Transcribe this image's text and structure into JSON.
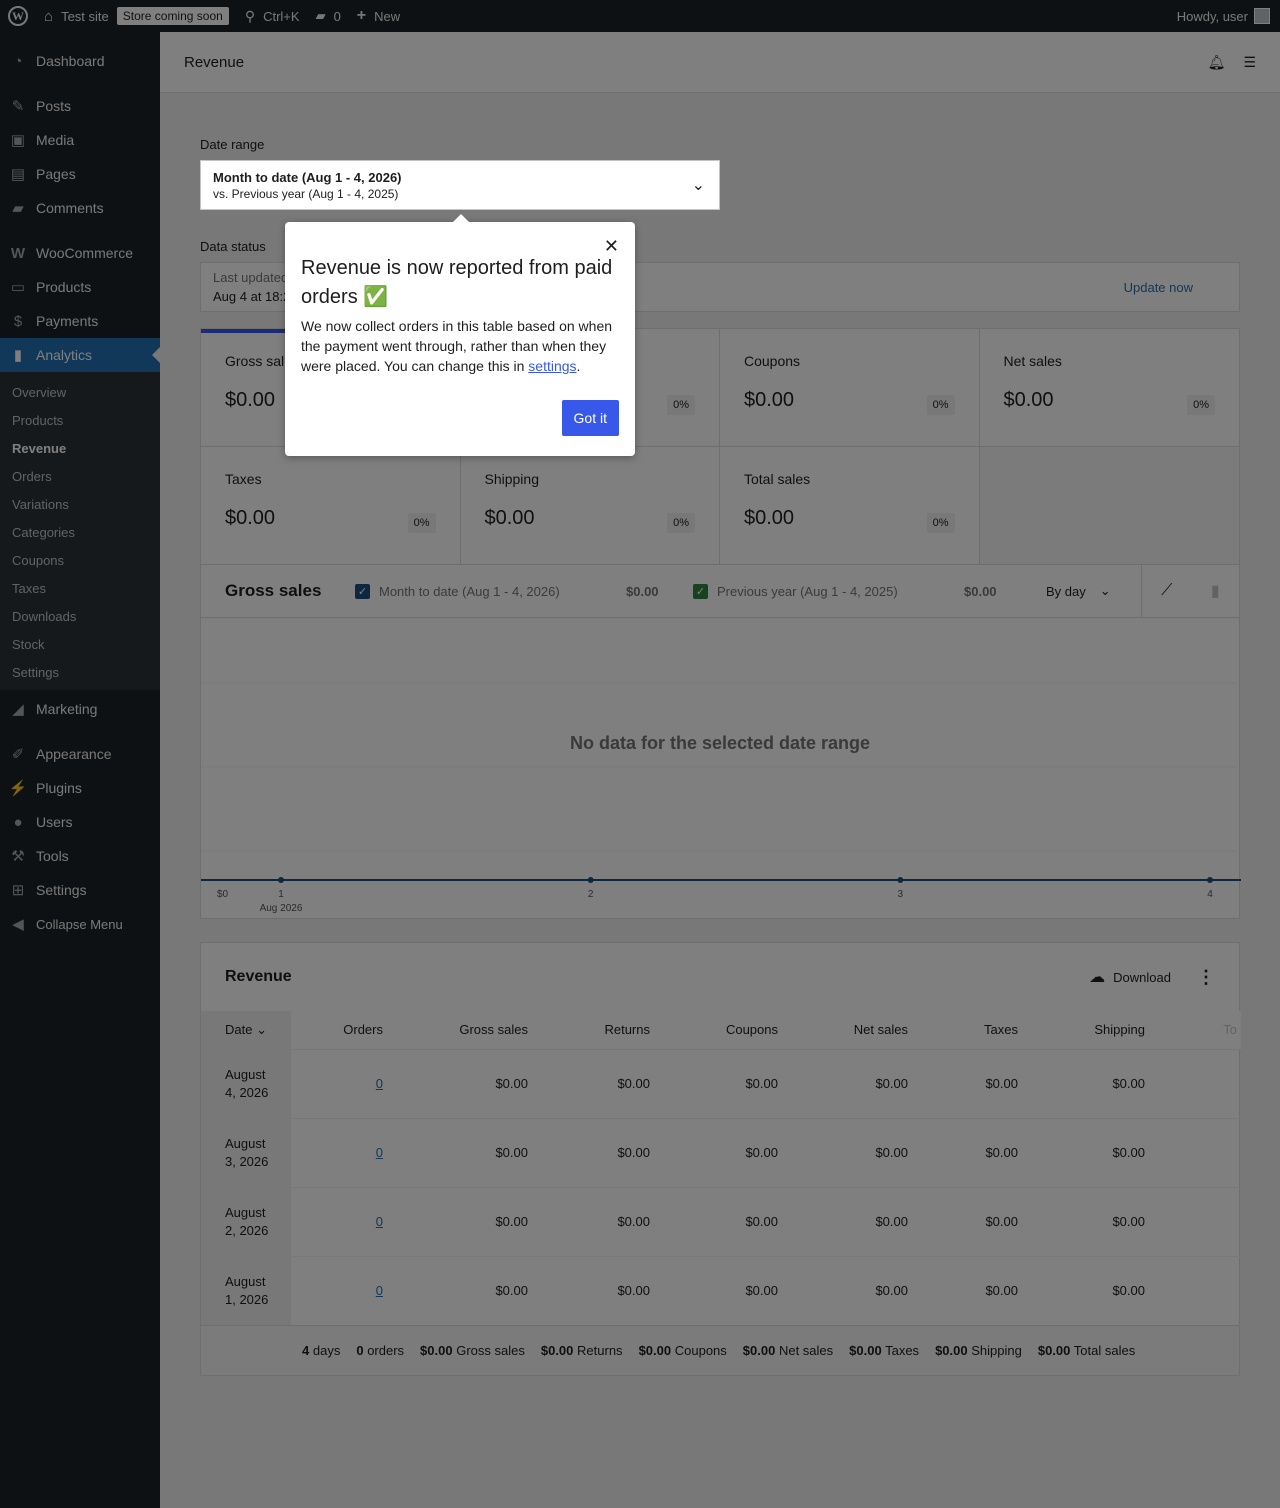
{
  "admin_bar": {
    "site_name": "Test site",
    "store_badge": "Store coming soon",
    "search_shortcut": "Ctrl+K",
    "comments_count": "0",
    "new_label": "New",
    "greeting": "Howdy, user"
  },
  "sidebar": {
    "items_top": [
      {
        "label": "Dashboard",
        "icon": "dashboard-icon"
      },
      {
        "label": "Posts",
        "icon": "pin-icon"
      },
      {
        "label": "Media",
        "icon": "media-icon"
      },
      {
        "label": "Pages",
        "icon": "pages-icon"
      },
      {
        "label": "Comments",
        "icon": "comments-icon"
      },
      {
        "label": "WooCommerce",
        "icon": "woo-icon"
      },
      {
        "label": "Products",
        "icon": "archive-icon"
      },
      {
        "label": "Payments",
        "icon": "dollar-icon"
      },
      {
        "label": "Analytics",
        "icon": "bar-chart-icon"
      }
    ],
    "analytics_submenu": [
      "Overview",
      "Products",
      "Revenue",
      "Orders",
      "Variations",
      "Categories",
      "Coupons",
      "Taxes",
      "Downloads",
      "Stock",
      "Settings"
    ],
    "current_submenu": "Revenue",
    "items_bottom": [
      {
        "label": "Marketing",
        "icon": "megaphone-icon"
      },
      {
        "label": "Appearance",
        "icon": "brush-icon"
      },
      {
        "label": "Plugins",
        "icon": "plug-icon"
      },
      {
        "label": "Users",
        "icon": "user-icon"
      },
      {
        "label": "Tools",
        "icon": "wrench-icon"
      },
      {
        "label": "Settings",
        "icon": "sliders-icon"
      },
      {
        "label": "Collapse Menu",
        "icon": "collapse-icon"
      }
    ]
  },
  "header": {
    "title": "Revenue"
  },
  "date_range": {
    "label": "Date range",
    "primary": "Month to date (Aug 1 - 4, 2026)",
    "secondary": "vs. Previous year (Aug 1 - 4, 2025)"
  },
  "data_status": {
    "label": "Data status",
    "line1": "Last updated",
    "line2": "Aug 4 at 18:2",
    "action": "Update now"
  },
  "summary": [
    {
      "label": "Gross sal",
      "value": "$0.00",
      "delta": ""
    },
    {
      "label": "",
      "value": "",
      "delta": "0%"
    },
    {
      "label": "Coupons",
      "value": "$0.00",
      "delta": "0%"
    },
    {
      "label": "Net sales",
      "value": "$0.00",
      "delta": "0%"
    },
    {
      "label": "Taxes",
      "value": "$0.00",
      "delta": "0%"
    },
    {
      "label": "Shipping",
      "value": "$0.00",
      "delta": "0%"
    },
    {
      "label": "Total sales",
      "value": "$0.00",
      "delta": "0%"
    }
  ],
  "chart": {
    "title": "Gross sales",
    "legend": [
      {
        "label": "Month to date (Aug 1 - 4, 2026)",
        "value": "$0.00",
        "color": "#1d4f7c"
      },
      {
        "label": "Previous year (Aug 1 - 4, 2025)",
        "value": "$0.00",
        "color": "#2e8540"
      }
    ],
    "interval": "By day",
    "no_data": "No data for the selected date range"
  },
  "chart_data": {
    "type": "line",
    "x": [
      "1",
      "2",
      "3",
      "4"
    ],
    "x_sublabel": "Aug 2026",
    "series": [
      {
        "name": "Month to date (Aug 1 - 4, 2026)",
        "values": [
          0,
          0,
          0,
          0
        ]
      }
    ],
    "y_tick": "$0"
  },
  "table": {
    "title": "Revenue",
    "download": "Download",
    "columns": [
      "Date",
      "Orders",
      "Gross sales",
      "Returns",
      "Coupons",
      "Net sales",
      "Taxes",
      "Shipping",
      "To"
    ],
    "rows": [
      {
        "date_line1": "August",
        "date_line2": "4, 2026",
        "orders": "0",
        "gross": "$0.00",
        "returns": "$0.00",
        "coupons": "$0.00",
        "net": "$0.00",
        "taxes": "$0.00",
        "shipping": "$0.00"
      },
      {
        "date_line1": "August",
        "date_line2": "3, 2026",
        "orders": "0",
        "gross": "$0.00",
        "returns": "$0.00",
        "coupons": "$0.00",
        "net": "$0.00",
        "taxes": "$0.00",
        "shipping": "$0.00"
      },
      {
        "date_line1": "August",
        "date_line2": "2, 2026",
        "orders": "0",
        "gross": "$0.00",
        "returns": "$0.00",
        "coupons": "$0.00",
        "net": "$0.00",
        "taxes": "$0.00",
        "shipping": "$0.00"
      },
      {
        "date_line1": "August",
        "date_line2": "1, 2026",
        "orders": "0",
        "gross": "$0.00",
        "returns": "$0.00",
        "coupons": "$0.00",
        "net": "$0.00",
        "taxes": "$0.00",
        "shipping": "$0.00"
      }
    ],
    "footer": [
      {
        "value": "4",
        "label": "days"
      },
      {
        "value": "0",
        "label": "orders"
      },
      {
        "value": "$0.00",
        "label": "Gross sales"
      },
      {
        "value": "$0.00",
        "label": "Returns"
      },
      {
        "value": "$0.00",
        "label": "Coupons"
      },
      {
        "value": "$0.00",
        "label": "Net sales"
      },
      {
        "value": "$0.00",
        "label": "Taxes"
      },
      {
        "value": "$0.00",
        "label": "Shipping"
      },
      {
        "value": "$0.00",
        "label": "Total sales"
      }
    ]
  },
  "popover": {
    "title": "Revenue is now reported from paid orders ✅",
    "body_before": "We now collect orders in this table based on when the payment went through, rather than when they were placed. You can change this in ",
    "link": "settings",
    "body_after": ".",
    "button": "Got it"
  }
}
